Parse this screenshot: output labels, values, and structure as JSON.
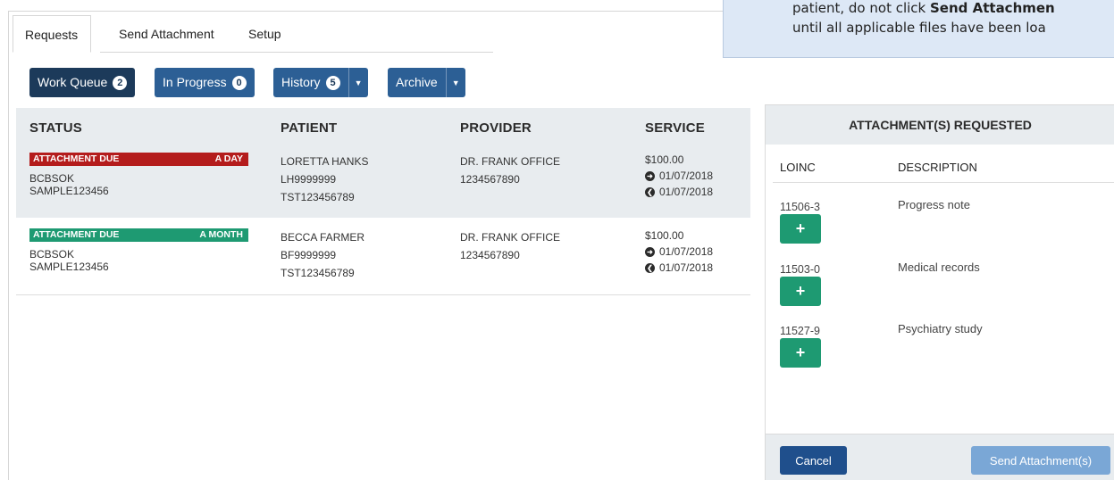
{
  "top_tabs": [
    "Requests",
    "Send Attachment",
    "Setup"
  ],
  "queue": {
    "work_queue": {
      "label": "Work Queue",
      "count": "2"
    },
    "in_progress": {
      "label": "In Progress",
      "count": "0"
    },
    "history": {
      "label": "History",
      "count": "5"
    },
    "archive": {
      "label": "Archive"
    }
  },
  "table": {
    "headers": {
      "status": "STATUS",
      "patient": "PATIENT",
      "provider": "PROVIDER",
      "service": "SERVICE"
    },
    "rows": [
      {
        "status_label": "ATTACHMENT DUE",
        "status_due": "A DAY",
        "status_color": "#b41c1c",
        "payer": "BCBSOK",
        "claim": "SAMPLE123456",
        "patient_name": "LORETTA HANKS",
        "patient_id": "LH9999999",
        "patient_tst": "TST123456789",
        "provider_name": "DR. FRANK OFFICE",
        "provider_id": "1234567890",
        "amount": "$100.00",
        "date_from": "01/07/2018",
        "date_to": "01/07/2018"
      },
      {
        "status_label": "ATTACHMENT DUE",
        "status_due": "A MONTH",
        "status_color": "#1e9a72",
        "payer": "BCBSOK",
        "claim": "SAMPLE123456",
        "patient_name": "BECCA FARMER",
        "patient_id": "BF9999999",
        "patient_tst": "TST123456789",
        "provider_name": "DR. FRANK OFFICE",
        "provider_id": "1234567890",
        "amount": "$100.00",
        "date_from": "01/07/2018",
        "date_to": "01/07/2018"
      }
    ]
  },
  "panel": {
    "title": "ATTACHMENT(S) REQUESTED",
    "col_loinc": "LOINC",
    "col_description": "DESCRIPTION",
    "items": [
      {
        "code": "11506-3",
        "description": "Progress note"
      },
      {
        "code": "11503-0",
        "description": "Medical records"
      },
      {
        "code": "11527-9",
        "description": "Psychiatry study"
      }
    ],
    "add_symbol": "+",
    "cancel_label": "Cancel",
    "send_label": "Send Attachment(s)"
  },
  "callout": {
    "line1_prefix": "patient, do not click ",
    "line1_bold": "Send Attachmen",
    "line2": "until all applicable files have been loa"
  },
  "colors": {
    "work_queue": "#1c3a5a",
    "queue_btn": "#2c5f95",
    "add_btn": "#1e9a72",
    "cancel_btn": "#1f4f8c",
    "send_btn": "#7aa7d6"
  }
}
